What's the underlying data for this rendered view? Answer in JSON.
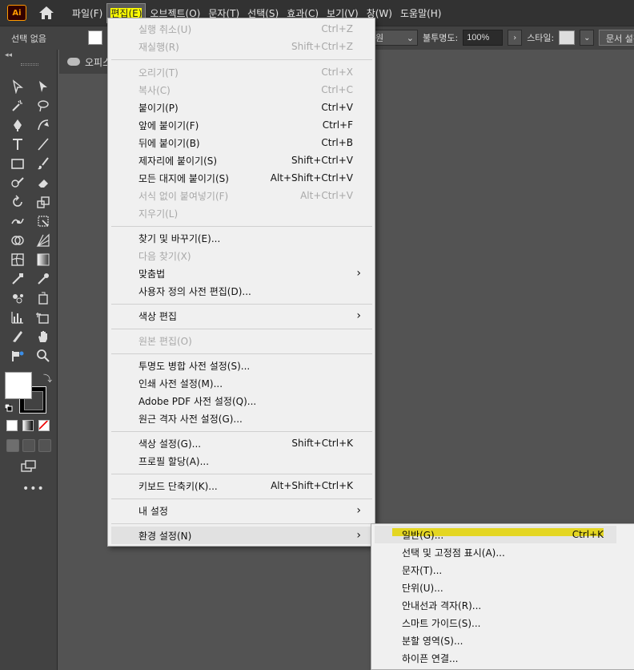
{
  "app": {
    "logo_text": "Ai"
  },
  "menubar": {
    "items": [
      "파일(F)",
      "편집(E)",
      "오브젝트(O)",
      "문자(T)",
      "선택(S)",
      "효과(C)",
      "보기(V)",
      "창(W)",
      "도움말(H)"
    ],
    "active_index": 1
  },
  "controlbar": {
    "selection": "선택 없음",
    "style_drop": "원",
    "opacity_label": "불투명도:",
    "opacity_value": "100%",
    "style_label": "스타일:",
    "doc_setup": "문서 설정"
  },
  "document": {
    "tab_title": "오피스"
  },
  "edit_menu": {
    "items": [
      {
        "label": "실행 취소(U)",
        "shortcut": "Ctrl+Z",
        "disabled": true
      },
      {
        "label": "재실행(R)",
        "shortcut": "Shift+Ctrl+Z",
        "disabled": true
      },
      {
        "label": "오리기(T)",
        "shortcut": "Ctrl+X",
        "disabled": true
      },
      {
        "label": "복사(C)",
        "shortcut": "Ctrl+C",
        "disabled": true
      },
      {
        "label": "붙이기(P)",
        "shortcut": "Ctrl+V",
        "disabled": false
      },
      {
        "label": "앞에 붙이기(F)",
        "shortcut": "Ctrl+F",
        "disabled": false
      },
      {
        "label": "뒤에 붙이기(B)",
        "shortcut": "Ctrl+B",
        "disabled": false
      },
      {
        "label": "제자리에 붙이기(S)",
        "shortcut": "Shift+Ctrl+V",
        "disabled": false
      },
      {
        "label": "모든 대지에 붙이기(S)",
        "shortcut": "Alt+Shift+Ctrl+V",
        "disabled": false
      },
      {
        "label": "서식 없이 붙여넣기(F)",
        "shortcut": "Alt+Ctrl+V",
        "disabled": true
      },
      {
        "label": "지우기(L)",
        "shortcut": "",
        "disabled": true
      },
      {
        "label": "찾기 및 바꾸기(E)...",
        "shortcut": "",
        "disabled": false
      },
      {
        "label": "다음 찾기(X)",
        "shortcut": "",
        "disabled": true
      },
      {
        "label": "맞춤법",
        "shortcut": "›",
        "disabled": false
      },
      {
        "label": "사용자 정의 사전 편집(D)...",
        "shortcut": "",
        "disabled": false
      },
      {
        "label": "색상 편집",
        "shortcut": "›",
        "disabled": false
      },
      {
        "label": "원본 편집(O)",
        "shortcut": "",
        "disabled": true
      },
      {
        "label": "투명도 병합 사전 설정(S)...",
        "shortcut": "",
        "disabled": false
      },
      {
        "label": "인쇄 사전 설정(M)...",
        "shortcut": "",
        "disabled": false
      },
      {
        "label": "Adobe PDF 사전 설정(Q)...",
        "shortcut": "",
        "disabled": false
      },
      {
        "label": "원근 격자 사전 설정(G)...",
        "shortcut": "",
        "disabled": false
      },
      {
        "label": "색상 설정(G)...",
        "shortcut": "Shift+Ctrl+K",
        "disabled": false
      },
      {
        "label": "프로필 할당(A)...",
        "shortcut": "",
        "disabled": false
      },
      {
        "label": "키보드 단축키(K)...",
        "shortcut": "Alt+Shift+Ctrl+K",
        "disabled": false
      },
      {
        "label": "내 설정",
        "shortcut": "›",
        "disabled": false
      },
      {
        "label": "환경 설정(N)",
        "shortcut": "›",
        "disabled": false
      }
    ]
  },
  "prefs_submenu": {
    "items": [
      {
        "label": "일반(G)...",
        "shortcut": "Ctrl+K"
      },
      {
        "label": "선택 및 고정점 표시(A)...",
        "shortcut": ""
      },
      {
        "label": "문자(T)...",
        "shortcut": ""
      },
      {
        "label": "단위(U)...",
        "shortcut": ""
      },
      {
        "label": "안내선과 격자(R)...",
        "shortcut": ""
      },
      {
        "label": "스마트 가이드(S)...",
        "shortcut": ""
      },
      {
        "label": "분할 영역(S)...",
        "shortcut": ""
      },
      {
        "label": "하이픈 연결...",
        "shortcut": ""
      }
    ]
  },
  "toolbar": {
    "more": "•••",
    "collapse": "◂◂"
  },
  "colors": {
    "highlight": "#ffee00",
    "menubar": "#323232",
    "panel": "#424242",
    "canvas": "#535353"
  }
}
